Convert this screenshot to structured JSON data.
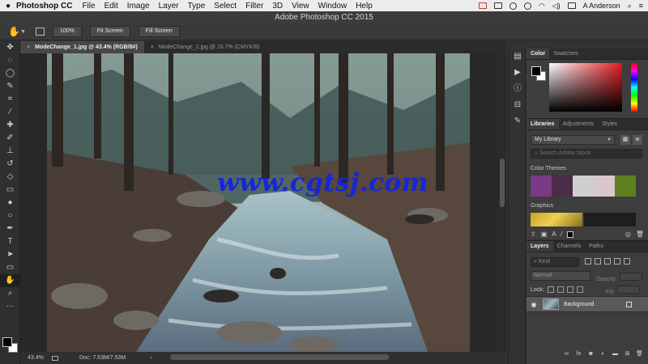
{
  "menubar": {
    "app_name": "Photoshop CC",
    "items": [
      "File",
      "Edit",
      "Image",
      "Layer",
      "Type",
      "Select",
      "Filter",
      "3D",
      "View",
      "Window",
      "Help"
    ],
    "user_name": "A Anderson"
  },
  "window": {
    "title": "Adobe Photoshop CC 2015"
  },
  "options_bar": {
    "tool_icon": "hand-icon",
    "buttons": [
      "100%",
      "Fit Screen",
      "Fill Screen"
    ]
  },
  "toolbar": {
    "tools": [
      "move-icon",
      "marquee-icon",
      "lasso-icon",
      "quick-select-icon",
      "crop-icon",
      "eyedropper-icon",
      "healing-icon",
      "brush-icon",
      "stamp-icon",
      "history-brush-icon",
      "eraser-icon",
      "gradient-icon",
      "blur-icon",
      "dodge-icon",
      "pen-icon",
      "type-icon",
      "path-select-icon",
      "shape-icon",
      "hand-icon",
      "zoom-icon",
      "more-icon"
    ],
    "foreground_color": "#000000",
    "background_color": "#ffffff"
  },
  "documents": {
    "tabs": [
      {
        "label": "ModeChange_1.jpg @ 43.4% (RGB/8#)",
        "active": true
      },
      {
        "label": "ModeChange_2.jpg @ 16.7% (CMYK/8)",
        "active": false
      }
    ]
  },
  "watermark": "www.cgtsj.com",
  "statusbar": {
    "zoom": "43.4%",
    "doc_info": "Doc: 7.53M/7.53M"
  },
  "color_panel": {
    "tabs": [
      "Color",
      "Swatches"
    ],
    "picker_hue": "#e31b23"
  },
  "libraries_panel": {
    "tabs": [
      "Libraries",
      "Adjustments",
      "Styles"
    ],
    "library_name": "My Library",
    "search_placeholder": "Search Adobe Stock",
    "color_themes_label": "Color Themes",
    "color_themes": [
      "#7a3a86",
      "#4b2c46",
      "#cfcfcf",
      "#d8c8cc",
      "#5d7f20"
    ],
    "graphics_label": "Graphics"
  },
  "layers_panel": {
    "tabs": [
      "Layers",
      "Channels",
      "Paths"
    ],
    "filter_label": "Kind",
    "blend_mode": "Normal",
    "opacity_label": "Opacity:",
    "lock_label": "Lock:",
    "fill_label": "Fill:",
    "layers": [
      {
        "name": "Background",
        "visible": true,
        "locked": true
      }
    ]
  }
}
